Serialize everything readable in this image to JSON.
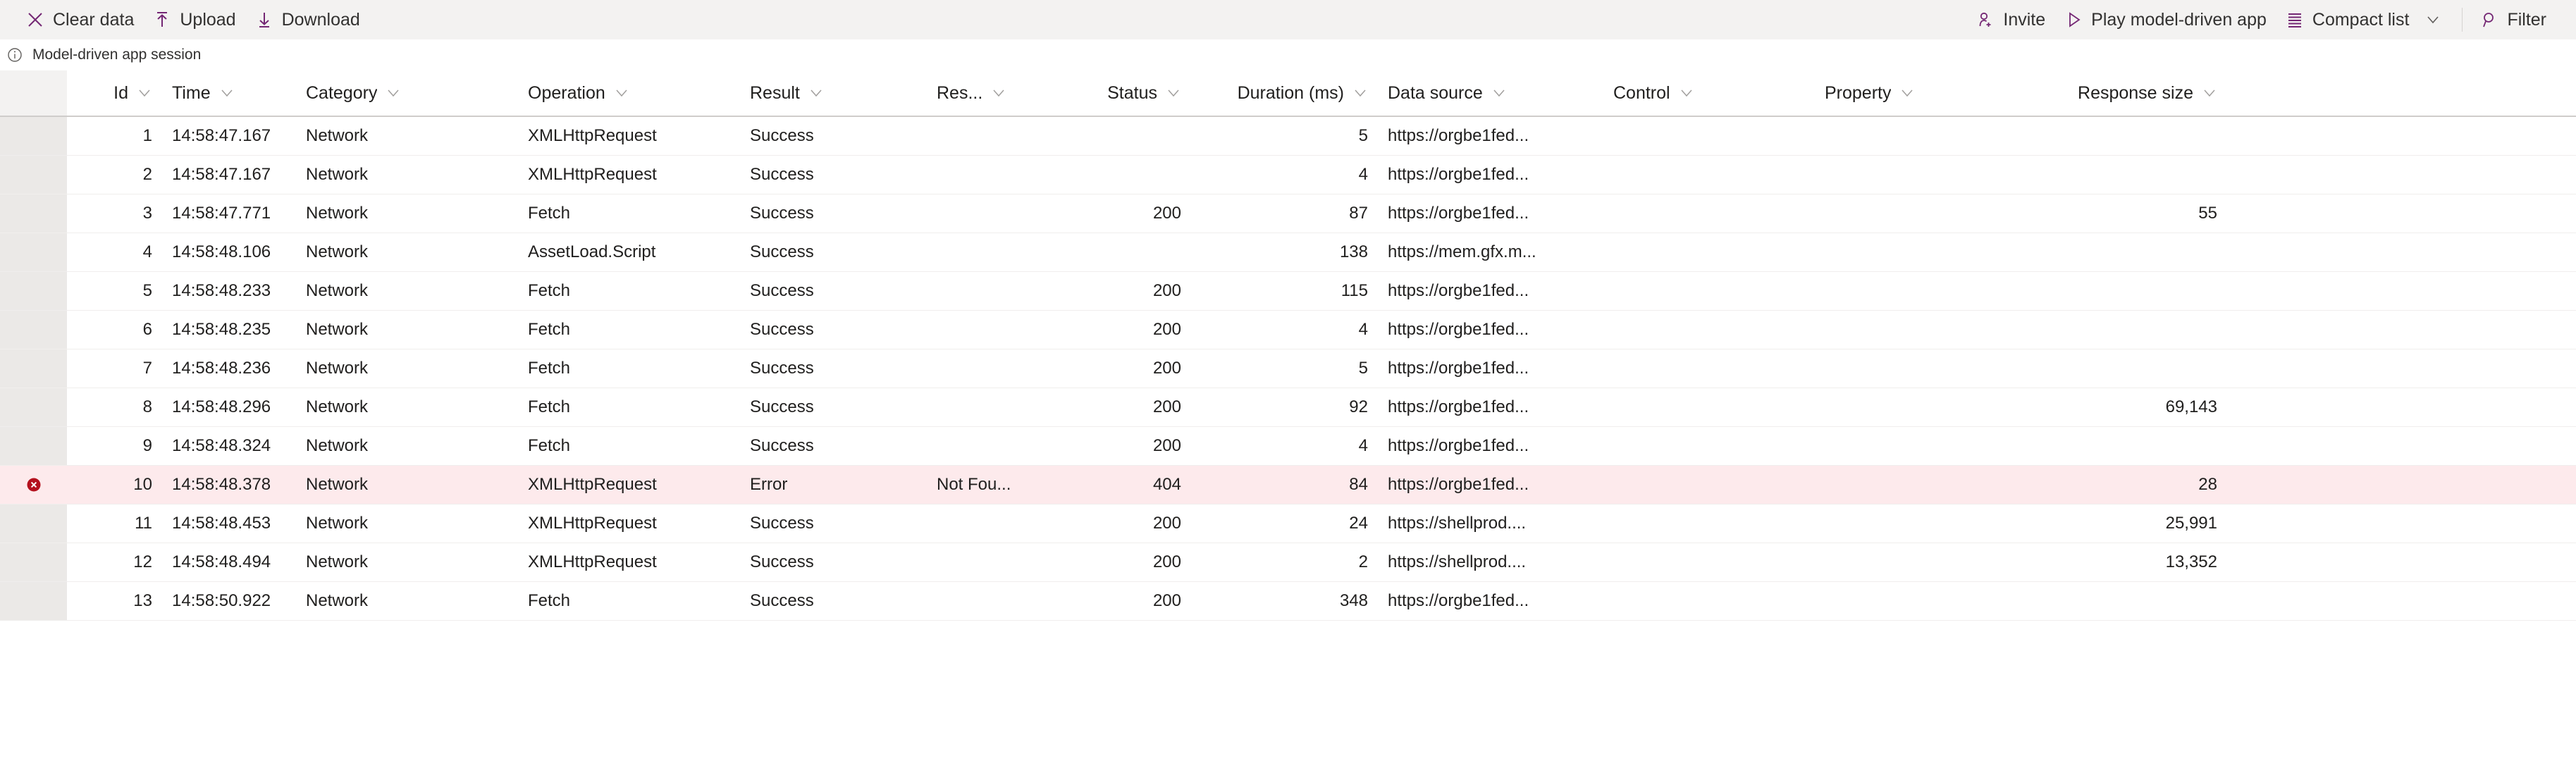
{
  "toolbar": {
    "left_items": [
      {
        "label": "Clear data",
        "icon": "close-x-icon"
      },
      {
        "label": "Upload",
        "icon": "upload-arrow-icon"
      },
      {
        "label": "Download",
        "icon": "download-arrow-icon"
      }
    ],
    "right_items": [
      {
        "label": "Invite",
        "icon": "person-add-icon",
        "chevron": false
      },
      {
        "label": "Play model-driven app",
        "icon": "play-triangle-icon",
        "chevron": false
      },
      {
        "label": "Compact list",
        "icon": "list-lines-icon",
        "chevron": true
      },
      {
        "label": "Filter",
        "icon": "search-magnifier-icon",
        "chevron": false
      }
    ],
    "accent_color": "#742774"
  },
  "session": {
    "icon": "info-circle-icon",
    "label": "Model-driven app session"
  },
  "grid": {
    "columns": [
      {
        "key": "id",
        "label": "Id",
        "align": "num",
        "cls": "c-id"
      },
      {
        "key": "time",
        "label": "Time",
        "align": "txt",
        "cls": "c-time"
      },
      {
        "key": "category",
        "label": "Category",
        "align": "txt",
        "cls": "c-cat"
      },
      {
        "key": "operation",
        "label": "Operation",
        "align": "txt",
        "cls": "c-op"
      },
      {
        "key": "result",
        "label": "Result",
        "align": "txt",
        "cls": "c-res"
      },
      {
        "key": "reason",
        "label": "Res...",
        "align": "txt",
        "cls": "c-resn"
      },
      {
        "key": "status",
        "label": "Status",
        "align": "num",
        "cls": "c-stat"
      },
      {
        "key": "duration",
        "label": "Duration (ms)",
        "align": "num",
        "cls": "c-dur"
      },
      {
        "key": "datasource",
        "label": "Data source",
        "align": "txt",
        "cls": "c-src"
      },
      {
        "key": "control",
        "label": "Control",
        "align": "txt",
        "cls": "c-ctrl"
      },
      {
        "key": "property",
        "label": "Property",
        "align": "txt",
        "cls": "c-prop"
      },
      {
        "key": "responsesize",
        "label": "Response size",
        "align": "num",
        "cls": "c-size"
      }
    ],
    "error_row_bg": "#fdeaec",
    "error_icon_color": "#b4111e",
    "rows": [
      {
        "id": "1",
        "time": "14:58:47.167",
        "category": "Network",
        "operation": "XMLHttpRequest",
        "result": "Success",
        "reason": "",
        "status": "",
        "duration": "5",
        "datasource": "https://orgbe1fed...",
        "control": "",
        "property": "",
        "responsesize": "",
        "error": false
      },
      {
        "id": "2",
        "time": "14:58:47.167",
        "category": "Network",
        "operation": "XMLHttpRequest",
        "result": "Success",
        "reason": "",
        "status": "",
        "duration": "4",
        "datasource": "https://orgbe1fed...",
        "control": "",
        "property": "",
        "responsesize": "",
        "error": false
      },
      {
        "id": "3",
        "time": "14:58:47.771",
        "category": "Network",
        "operation": "Fetch",
        "result": "Success",
        "reason": "",
        "status": "200",
        "duration": "87",
        "datasource": "https://orgbe1fed...",
        "control": "",
        "property": "",
        "responsesize": "55",
        "error": false
      },
      {
        "id": "4",
        "time": "14:58:48.106",
        "category": "Network",
        "operation": "AssetLoad.Script",
        "result": "Success",
        "reason": "",
        "status": "",
        "duration": "138",
        "datasource": "https://mem.gfx.m...",
        "control": "",
        "property": "",
        "responsesize": "",
        "error": false
      },
      {
        "id": "5",
        "time": "14:58:48.233",
        "category": "Network",
        "operation": "Fetch",
        "result": "Success",
        "reason": "",
        "status": "200",
        "duration": "115",
        "datasource": "https://orgbe1fed...",
        "control": "",
        "property": "",
        "responsesize": "",
        "error": false
      },
      {
        "id": "6",
        "time": "14:58:48.235",
        "category": "Network",
        "operation": "Fetch",
        "result": "Success",
        "reason": "",
        "status": "200",
        "duration": "4",
        "datasource": "https://orgbe1fed...",
        "control": "",
        "property": "",
        "responsesize": "",
        "error": false
      },
      {
        "id": "7",
        "time": "14:58:48.236",
        "category": "Network",
        "operation": "Fetch",
        "result": "Success",
        "reason": "",
        "status": "200",
        "duration": "5",
        "datasource": "https://orgbe1fed...",
        "control": "",
        "property": "",
        "responsesize": "",
        "error": false
      },
      {
        "id": "8",
        "time": "14:58:48.296",
        "category": "Network",
        "operation": "Fetch",
        "result": "Success",
        "reason": "",
        "status": "200",
        "duration": "92",
        "datasource": "https://orgbe1fed...",
        "control": "",
        "property": "",
        "responsesize": "69,143",
        "error": false
      },
      {
        "id": "9",
        "time": "14:58:48.324",
        "category": "Network",
        "operation": "Fetch",
        "result": "Success",
        "reason": "",
        "status": "200",
        "duration": "4",
        "datasource": "https://orgbe1fed...",
        "control": "",
        "property": "",
        "responsesize": "",
        "error": false
      },
      {
        "id": "10",
        "time": "14:58:48.378",
        "category": "Network",
        "operation": "XMLHttpRequest",
        "result": "Error",
        "reason": "Not Fou...",
        "status": "404",
        "duration": "84",
        "datasource": "https://orgbe1fed...",
        "control": "",
        "property": "",
        "responsesize": "28",
        "error": true
      },
      {
        "id": "11",
        "time": "14:58:48.453",
        "category": "Network",
        "operation": "XMLHttpRequest",
        "result": "Success",
        "reason": "",
        "status": "200",
        "duration": "24",
        "datasource": "https://shellprod....",
        "control": "",
        "property": "",
        "responsesize": "25,991",
        "error": false
      },
      {
        "id": "12",
        "time": "14:58:48.494",
        "category": "Network",
        "operation": "XMLHttpRequest",
        "result": "Success",
        "reason": "",
        "status": "200",
        "duration": "2",
        "datasource": "https://shellprod....",
        "control": "",
        "property": "",
        "responsesize": "13,352",
        "error": false
      },
      {
        "id": "13",
        "time": "14:58:50.922",
        "category": "Network",
        "operation": "Fetch",
        "result": "Success",
        "reason": "",
        "status": "200",
        "duration": "348",
        "datasource": "https://orgbe1fed...",
        "control": "",
        "property": "",
        "responsesize": "",
        "error": false
      }
    ]
  }
}
